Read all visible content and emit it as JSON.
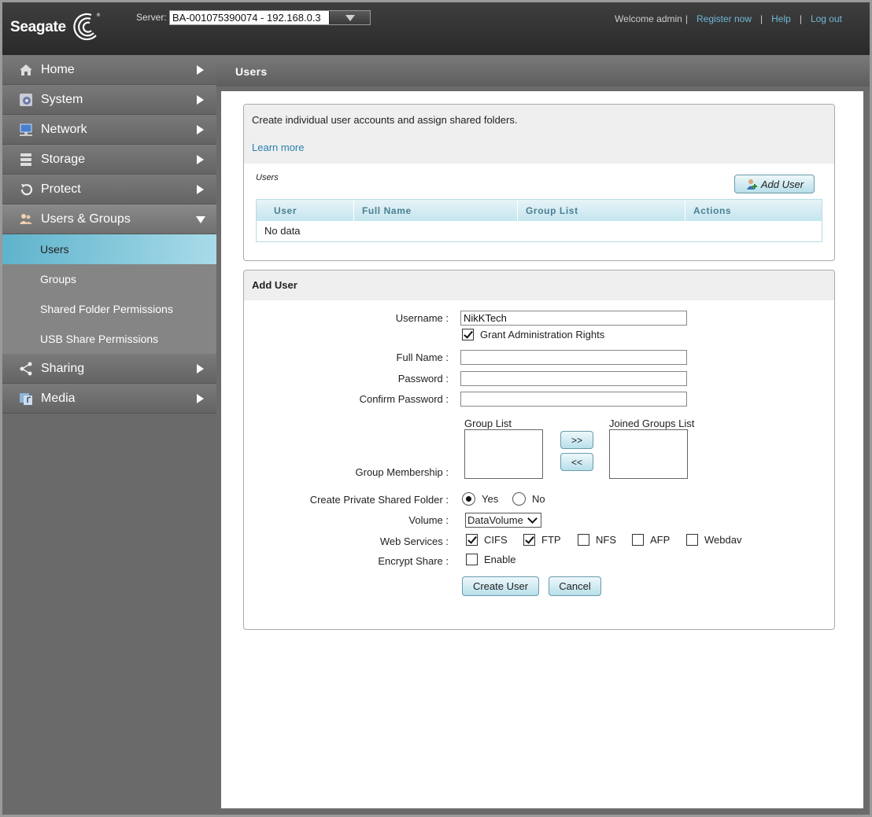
{
  "header": {
    "logo_text": "Seagate",
    "server_label": "Server:",
    "server_value": "BA-001075390074 - 192.168.0.3",
    "welcome": "Welcome admin",
    "register": "Register now",
    "help": "Help",
    "logout": "Log out"
  },
  "sidebar": {
    "items": [
      {
        "label": "Home",
        "icon": "home-icon"
      },
      {
        "label": "System",
        "icon": "gear-icon"
      },
      {
        "label": "Network",
        "icon": "network-icon"
      },
      {
        "label": "Storage",
        "icon": "storage-icon"
      },
      {
        "label": "Protect",
        "icon": "protect-icon"
      },
      {
        "label": "Users & Groups",
        "icon": "users-icon"
      },
      {
        "label": "Sharing",
        "icon": "share-icon"
      },
      {
        "label": "Media",
        "icon": "media-icon"
      }
    ],
    "sub_items": [
      {
        "label": "Users"
      },
      {
        "label": "Groups"
      },
      {
        "label": "Shared Folder Permissions"
      },
      {
        "label": "USB Share Permissions"
      }
    ]
  },
  "main": {
    "title": "Users",
    "info_text": "Create individual user accounts and assign shared folders.",
    "learn_more": "Learn more",
    "users_caption": "Users",
    "add_user_btn": "Add User",
    "table": {
      "headers": [
        "User",
        "Full Name",
        "Group List",
        "Actions"
      ],
      "empty": "No data"
    }
  },
  "form": {
    "title": "Add User",
    "username_label": "Username :",
    "username_value": "NikKTech",
    "grant_admin": "Grant Administration Rights",
    "fullname_label": "Full Name :",
    "password_label": "Password :",
    "confirm_label": "Confirm Password :",
    "group_list_title": "Group List",
    "joined_list_title": "Joined Groups List",
    "add_btn": ">>",
    "remove_btn": "<<",
    "membership_label": "Group Membership :",
    "private_label": "Create Private Shared Folder :",
    "yes": "Yes",
    "no": "No",
    "volume_label": "Volume :",
    "volume_value": "DataVolume",
    "web_label": "Web Services :",
    "services": [
      {
        "label": "CIFS",
        "checked": true
      },
      {
        "label": "FTP",
        "checked": true
      },
      {
        "label": "NFS",
        "checked": false
      },
      {
        "label": "AFP",
        "checked": false
      },
      {
        "label": "Webdav",
        "checked": false
      }
    ],
    "encrypt_label": "Encrypt Share :",
    "enable": "Enable",
    "create_btn": "Create User",
    "cancel_btn": "Cancel"
  }
}
